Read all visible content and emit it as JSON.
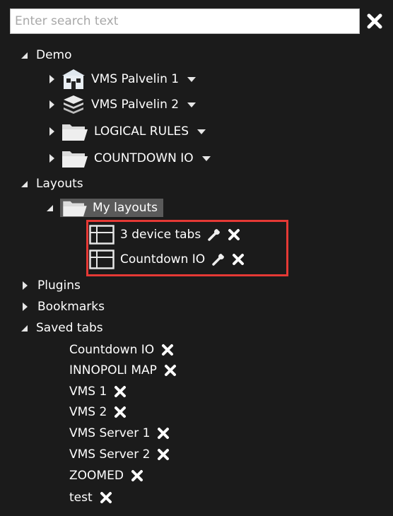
{
  "search": {
    "placeholder": "Enter search text",
    "value": ""
  },
  "tree": {
    "demo": {
      "label": "Demo",
      "children": [
        {
          "label": "VMS Palvelin 1",
          "icon": "server-building-icon"
        },
        {
          "label": "VMS Palvelin 2",
          "icon": "server-stack-icon"
        },
        {
          "label": "LOGICAL RULES",
          "icon": "folder-icon"
        },
        {
          "label": "COUNTDOWN IO",
          "icon": "folder-icon"
        }
      ]
    },
    "layouts": {
      "label": "Layouts",
      "my_layouts": {
        "label": "My layouts",
        "items": [
          {
            "label": "3 device tabs"
          },
          {
            "label": "Countdown IO"
          }
        ]
      }
    },
    "plugins": {
      "label": "Plugins"
    },
    "bookmarks": {
      "label": "Bookmarks"
    },
    "saved_tabs": {
      "label": "Saved tabs",
      "items": [
        {
          "label": "Countdown IO"
        },
        {
          "label": "INNOPOLI MAP"
        },
        {
          "label": "VMS 1"
        },
        {
          "label": "VMS 2"
        },
        {
          "label": "VMS Server 1"
        },
        {
          "label": "VMS Server 2"
        },
        {
          "label": "ZOOMED"
        },
        {
          "label": "test"
        }
      ]
    }
  },
  "colors": {
    "background": "#1b1b1b",
    "text": "#ffffff",
    "selection": "#5a5a5a",
    "highlight_border": "#e53935"
  }
}
